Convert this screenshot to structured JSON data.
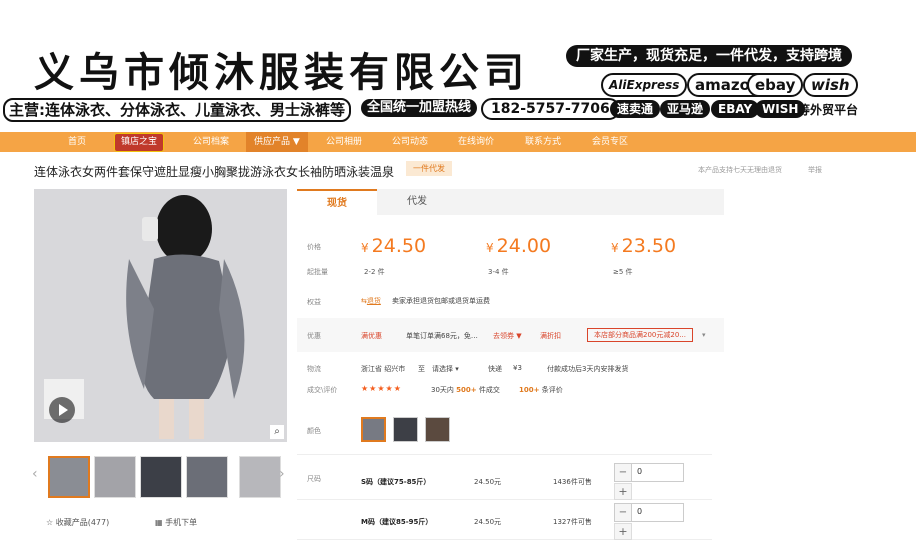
{
  "banner": {
    "company_name": "义乌市倾沐服装有限公司",
    "slogan": "厂家生产，现货充足，一件代发，支持跨境",
    "brands": [
      "AliExpress",
      "amazon",
      "ebay",
      "wish"
    ],
    "main_business": "主营:连体泳衣、分体泳衣、儿童泳衣、男士泳裤等",
    "hotline_label": "全国统一加盟热线",
    "phone": "182-5757-7706",
    "platforms": [
      "速卖通",
      "亚马逊",
      "EBAY",
      "WISH"
    ],
    "platforms_suffix": "等外贸平台"
  },
  "nav": {
    "items": [
      "首页",
      "镇店之宝",
      "公司档案",
      "供应产品 ▼",
      "公司相册",
      "公司动态",
      "在线询价",
      "联系方式",
      "会员专区"
    ]
  },
  "product": {
    "title": "连体泳衣女两件套保守遮肚显瘦小胸聚拢游泳衣女长袖防晒泳装温泉",
    "badge": "一件代发",
    "note": "本产品支持七天无理由退货",
    "report": "举报",
    "favorite": "收藏产品(477)",
    "mobile": "手机下单"
  },
  "tabs": [
    "现货",
    "代发"
  ],
  "pricing": {
    "price_label": "价格",
    "qty_label": "起批量",
    "tiers": [
      {
        "price": "24.50",
        "qty": "2-2 件"
      },
      {
        "price": "24.00",
        "qty": "3-4 件"
      },
      {
        "price": "23.50",
        "qty": "≥5 件"
      }
    ],
    "currency": "¥"
  },
  "rights": {
    "label": "权益",
    "tag": "退货",
    "text": "卖家承担退货包邮或退货单运费"
  },
  "promo": {
    "label": "优惠",
    "coupon": "满优惠",
    "desc": "单笔订单满68元，免…",
    "more": "去领券 ▼",
    "discount": "满折扣",
    "highlight": "本店部分商品满200元减20...",
    "chev": "▾"
  },
  "shipping": {
    "label": "物流",
    "from": "浙江省 绍兴市",
    "to": "至",
    "select": "请选择",
    "express": "快递",
    "fee": "¥3",
    "promise": "付款成功后3天内安排发货"
  },
  "reviews": {
    "label": "成交\\评价",
    "stars": "★★★★★",
    "sold_prefix": "30天内",
    "sold_num": "500+",
    "sold_suffix": "件成交",
    "review_num": "100+",
    "review_suffix": "条评价"
  },
  "color": {
    "label": "颜色"
  },
  "sizes": {
    "label": "尺码",
    "rows": [
      {
        "name": "S码（建议75-85斤）",
        "price": "24.50元",
        "stock": "1436件可售",
        "qty": "0"
      },
      {
        "name": "M码（建议85-95斤）",
        "price": "24.50元",
        "stock": "1327件可售",
        "qty": "0"
      }
    ]
  },
  "colors": {
    "accent": "#f47a20",
    "nav_bg": "#f5a445"
  }
}
